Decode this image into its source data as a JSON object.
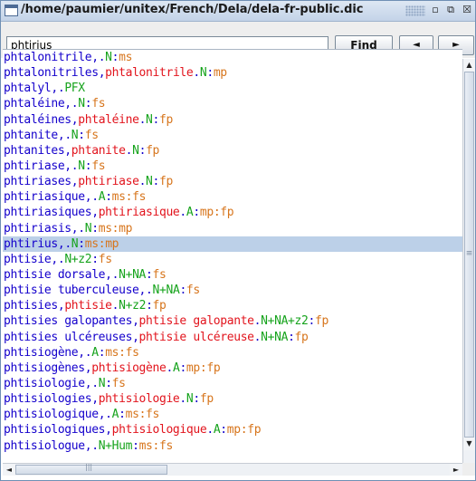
{
  "window": {
    "title": "/home/paumier/unitex/French/Dela/dela-fr-public.dic",
    "minimize_glyph": "▫",
    "maximize_glyph": "⧉",
    "close_glyph": "☒"
  },
  "toolbar": {
    "search_value": "phtirius",
    "find_label": "Find",
    "prev_glyph": "◄",
    "next_glyph": "►"
  },
  "colors": {
    "inflected": "#1400cc",
    "lemma": "#e2141d",
    "category": "#16a31c",
    "inflection_codes": "#d7751c",
    "selection": "#bcd0e8"
  },
  "entries": [
    {
      "inflected": "phtalonitrile",
      "lemma": "",
      "category": "N",
      "codes": "ms"
    },
    {
      "inflected": "phtalonitriles",
      "lemma": "phtalonitrile",
      "category": "N",
      "codes": "mp"
    },
    {
      "inflected": "phtalyl",
      "lemma": "",
      "category": "PFX",
      "codes": ""
    },
    {
      "inflected": "phtaléine",
      "lemma": "",
      "category": "N",
      "codes": "fs"
    },
    {
      "inflected": "phtaléines",
      "lemma": "phtaléine",
      "category": "N",
      "codes": "fp"
    },
    {
      "inflected": "phtanite",
      "lemma": "",
      "category": "N",
      "codes": "fs"
    },
    {
      "inflected": "phtanites",
      "lemma": "phtanite",
      "category": "N",
      "codes": "fp"
    },
    {
      "inflected": "phtiriase",
      "lemma": "",
      "category": "N",
      "codes": "fs"
    },
    {
      "inflected": "phtiriases",
      "lemma": "phtiriase",
      "category": "N",
      "codes": "fp"
    },
    {
      "inflected": "phtiriasique",
      "lemma": "",
      "category": "A",
      "codes": "ms:fs"
    },
    {
      "inflected": "phtiriasiques",
      "lemma": "phtiriasique",
      "category": "A",
      "codes": "mp:fp"
    },
    {
      "inflected": "phtiriasis",
      "lemma": "",
      "category": "N",
      "codes": "ms:mp"
    },
    {
      "inflected": "phtirius",
      "lemma": "",
      "category": "N",
      "codes": "ms:mp",
      "selected": true
    },
    {
      "inflected": "phtisie",
      "lemma": "",
      "category": "N+z2",
      "codes": "fs"
    },
    {
      "inflected": "phtisie dorsale",
      "lemma": "",
      "category": "N+NA",
      "codes": "fs"
    },
    {
      "inflected": "phtisie tuberculeuse",
      "lemma": "",
      "category": "N+NA",
      "codes": "fs"
    },
    {
      "inflected": "phtisies",
      "lemma": "phtisie",
      "category": "N+z2",
      "codes": "fp"
    },
    {
      "inflected": "phtisies galopantes",
      "lemma": "phtisie galopante",
      "category": "N+NA+z2",
      "codes": "fp"
    },
    {
      "inflected": "phtisies ulcéreuses",
      "lemma": "phtisie ulcéreuse",
      "category": "N+NA",
      "codes": "fp"
    },
    {
      "inflected": "phtisiogène",
      "lemma": "",
      "category": "A",
      "codes": "ms:fs"
    },
    {
      "inflected": "phtisiogènes",
      "lemma": "phtisiogène",
      "category": "A",
      "codes": "mp:fp"
    },
    {
      "inflected": "phtisiologie",
      "lemma": "",
      "category": "N",
      "codes": "fs"
    },
    {
      "inflected": "phtisiologies",
      "lemma": "phtisiologie",
      "category": "N",
      "codes": "fp"
    },
    {
      "inflected": "phtisiologique",
      "lemma": "",
      "category": "A",
      "codes": "ms:fs"
    },
    {
      "inflected": "phtisiologiques",
      "lemma": "phtisiologique",
      "category": "A",
      "codes": "mp:fp"
    },
    {
      "inflected": "phtisiologue",
      "lemma": "",
      "category": "N+Hum",
      "codes": "ms:fs"
    }
  ]
}
